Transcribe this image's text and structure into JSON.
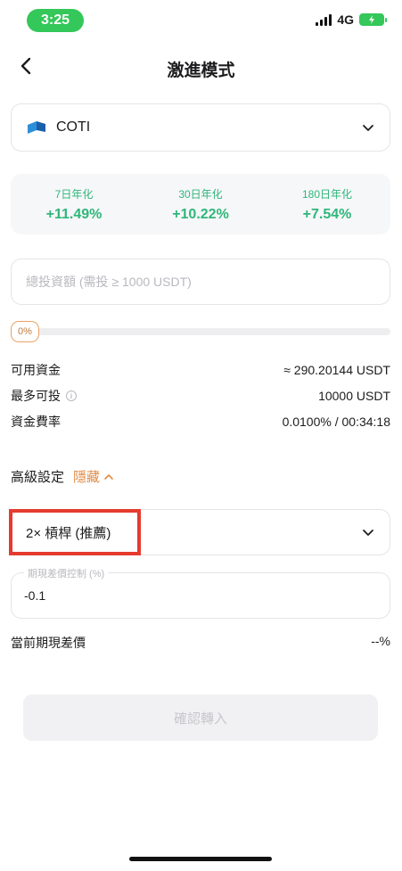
{
  "status_bar": {
    "time": "3:25",
    "network": "4G"
  },
  "header": {
    "title": "激進模式"
  },
  "coin": {
    "name": "COTI"
  },
  "yields": [
    {
      "label": "7日年化",
      "value": "+11.49%"
    },
    {
      "label": "30日年化",
      "value": "+10.22%"
    },
    {
      "label": "180日年化",
      "value": "+7.54%"
    }
  ],
  "invest": {
    "placeholder": "總投資額 (需投 ≥ 1000 USDT)",
    "value": ""
  },
  "slider": {
    "percent_label": "0%",
    "percent": 0
  },
  "info": [
    {
      "label": "可用資金",
      "value": "≈ 290.20144 USDT"
    },
    {
      "label": "最多可投",
      "value": "10000 USDT"
    },
    {
      "label": "資金費率",
      "value": "0.0100% / 00:34:18"
    }
  ],
  "advanced": {
    "label": "高級設定",
    "toggle_label": "隱藏"
  },
  "leverage": {
    "label": "2× 槓桿 (推薦)"
  },
  "spread": {
    "legend": "期現差價控制 (%)",
    "value": "-0.1"
  },
  "current_spread": {
    "label": "當前期現差價",
    "value": "--%"
  },
  "submit": {
    "label": "確認轉入"
  },
  "colors": {
    "green": "#2fb67a",
    "orange": "#e08b45",
    "highlight": "#e53b2f",
    "status_green": "#34c759"
  }
}
